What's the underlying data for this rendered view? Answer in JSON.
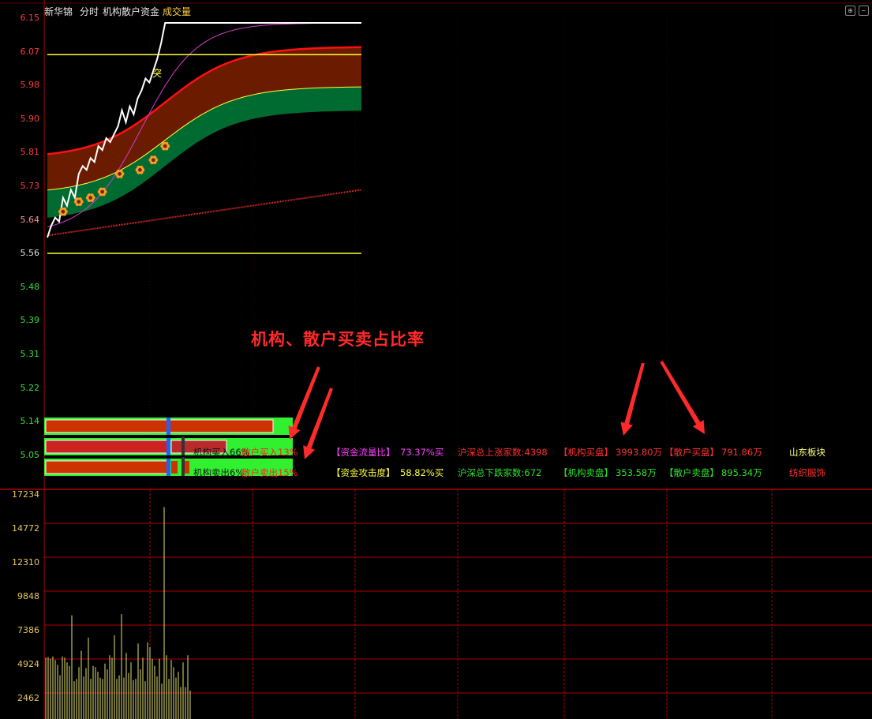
{
  "header": {
    "stock_name": "新华锦",
    "view_mode": "分时",
    "indicator_name": "机构散户资金",
    "volume_label": "成交量"
  },
  "price_axis": {
    "labels": [
      "6.15",
      "6.07",
      "5.98",
      "5.90",
      "5.81",
      "5.73",
      "5.64",
      "5.56",
      "5.48",
      "5.39",
      "5.31",
      "5.22",
      "5.14",
      "5.05"
    ],
    "up_color": "#ff3b3b",
    "down_color": "#3bdc3b"
  },
  "volume_axis": {
    "labels": [
      "17234",
      "14772",
      "12310",
      "9848",
      "7386",
      "4924",
      "2462"
    ]
  },
  "chart_data": [
    {
      "type": "line",
      "title": "",
      "series": [
        {
          "name": "price",
          "color": "#ffffff",
          "x": [
            0,
            5,
            10,
            15,
            20,
            25,
            30,
            35,
            40,
            45,
            50,
            55,
            60,
            65,
            70,
            75,
            80,
            85,
            90,
            95,
            100,
            105,
            110,
            115,
            120,
            125,
            130,
            135,
            140,
            145,
            150,
            160,
            200,
            260,
            320,
            380,
            400
          ],
          "values": [
            5.6,
            5.63,
            5.65,
            5.64,
            5.7,
            5.68,
            5.72,
            5.7,
            5.76,
            5.78,
            5.77,
            5.8,
            5.79,
            5.83,
            5.82,
            5.85,
            5.84,
            5.86,
            5.88,
            5.92,
            5.89,
            5.93,
            5.91,
            5.95,
            5.97,
            6.0,
            5.99,
            6.02,
            6.05,
            6.09,
            6.14,
            6.14,
            6.14,
            6.14,
            6.14,
            6.14,
            6.14
          ]
        }
      ],
      "reference_lines": [
        6.06,
        5.56
      ],
      "signal_label": "突",
      "ylim": [
        5.01,
        6.17
      ]
    },
    {
      "type": "bar",
      "title": "",
      "ylim": [
        0,
        17234
      ],
      "values": [
        3000,
        3050,
        2900,
        3100,
        2800,
        2400,
        1500,
        3100,
        3000,
        2600,
        2300,
        6600,
        1000,
        1200,
        2200,
        3600,
        1400,
        2100,
        4700,
        1200,
        2300,
        2200,
        1800,
        1300,
        1200,
        2500,
        2000,
        3200,
        3000,
        4900,
        1200,
        1500,
        6700,
        1300,
        3400,
        1700,
        2600,
        1100,
        1200,
        4200,
        2000,
        3000,
        1000,
        4300,
        3900,
        2900,
        2300,
        1400,
        2900,
        800,
        15800,
        3200,
        1200,
        2800,
        2200,
        1300,
        1800,
        500,
        2600,
        500,
        3200,
        200
      ]
    }
  ],
  "stats": {
    "inst_buy_pct": "机构买入66%",
    "retail_buy_pct": "散户买入13%",
    "inst_sell_pct": "机构卖出6%",
    "retail_sell_pct": "散户卖出15%",
    "flow_ratio_label": "【资金流量比】",
    "flow_ratio_value": "73.37%买",
    "attack_label": "【资金攻击度】",
    "attack_value": "58.82%买",
    "rise_count": "沪深总上涨家数:4398",
    "fall_count": "沪深总下跌家数:672",
    "inst_buy_label": "【机构买盘】",
    "inst_buy_value": "3993.80万",
    "retail_buy_label": "【散户买盘】",
    "retail_buy_value": "791.86万",
    "inst_sell_label": "【机构卖盘】",
    "inst_sell_value": "353.58万",
    "retail_sell_label": "【散户卖盘】",
    "retail_sell_value": "895.34万",
    "sector_title": "山东板块",
    "sector_name": "纺织服饰"
  },
  "ratio_bars": {
    "inst_buy": 0.66,
    "retail_buy": 0.13,
    "inst_sell": 0.06,
    "retail_sell": 0.15
  },
  "annotation": {
    "text": "机构、散户买卖占比率",
    "color": "#ff2a2a"
  },
  "colors": {
    "grid": "#b00000",
    "price_line": "#ffffff",
    "avg_line": "#ffff44",
    "band_red": "#6b1c00",
    "band_green": "#006b30",
    "volume": "#e0e070"
  }
}
